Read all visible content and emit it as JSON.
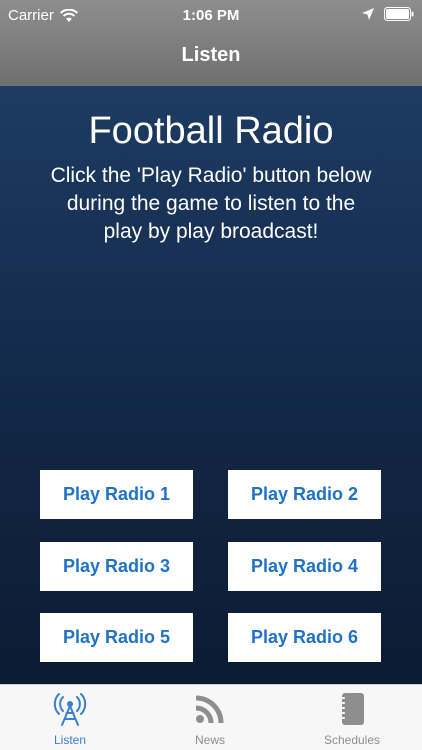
{
  "status_bar": {
    "carrier": "Carrier",
    "time": "1:06 PM",
    "icons": [
      "wifi-icon",
      "location-arrow-icon",
      "battery-icon"
    ]
  },
  "nav": {
    "title": "Listen"
  },
  "main": {
    "title": "Football Radio",
    "description": "Click the 'Play Radio' button below during the game to listen to the play by play broadcast!",
    "buttons": [
      "Play Radio 1",
      "Play Radio 2",
      "Play Radio 3",
      "Play Radio 4",
      "Play Radio 5",
      "Play Radio 6"
    ]
  },
  "tabs": [
    {
      "label": "Listen",
      "icon": "radio-tower-icon",
      "active": true
    },
    {
      "label": "News",
      "icon": "rss-icon",
      "active": false
    },
    {
      "label": "Schedules",
      "icon": "notebook-icon",
      "active": false
    }
  ],
  "colors": {
    "header": "#7f7f7f",
    "background_top": "#1d3b63",
    "background_bottom": "#0c1b33",
    "button_text": "#1f72c7",
    "tab_active": "#3a7fd0",
    "tab_inactive": "#8e8e8e"
  }
}
